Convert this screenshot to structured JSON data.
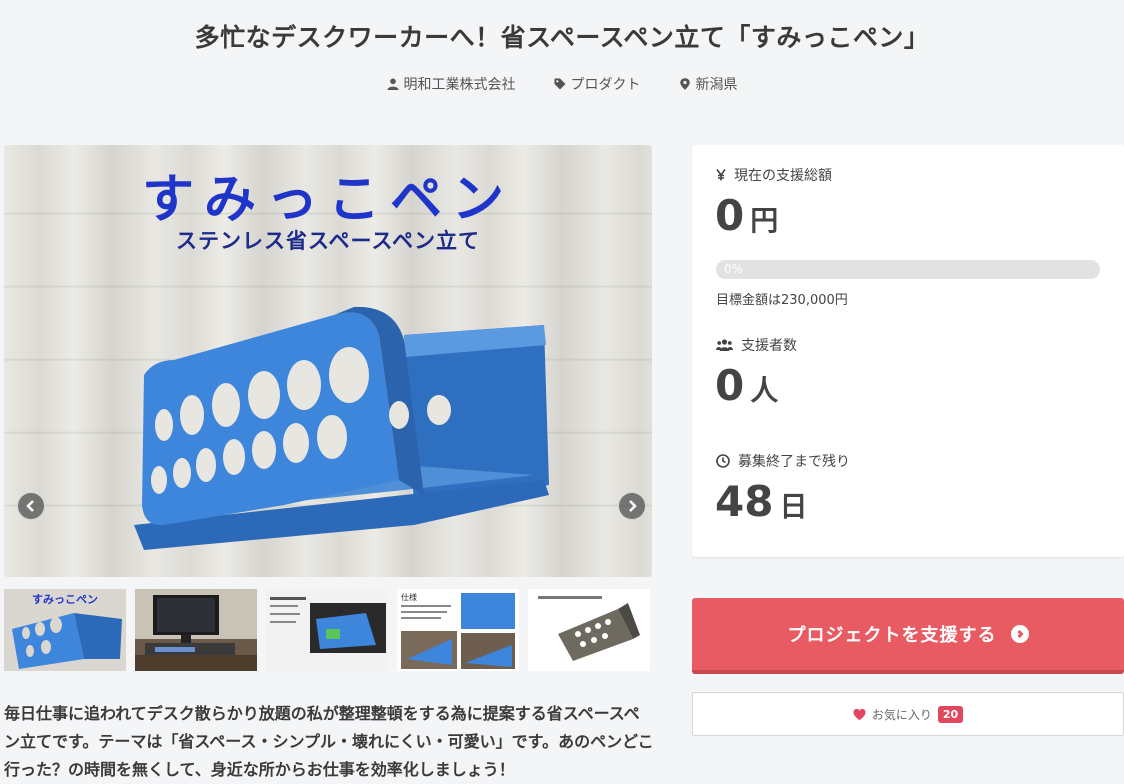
{
  "project": {
    "title": "多忙なデスクワーカーへ！省スペースペン立て「すみっこペン」",
    "owner": "明和工業株式会社",
    "category": "プロダクト",
    "location": "新潟県"
  },
  "hero": {
    "title": "すみっこペン",
    "subtitle": "ステンレス省スペースペン立て"
  },
  "description": "毎日仕事に追われてデスク散らかり放題の私が整理整頓をする為に提案する省スペースペン立てです。テーマは「省スペース・シンプル・壊れにくい・可愛い」です。あのペンどこ行った？の時間を無くして、身近な所からお仕事を効率化しましょう！",
  "panel": {
    "total_label": "現在の支援総額",
    "total_value": "0",
    "total_unit": "円",
    "progress_label": "0%",
    "progress_fraction": 0,
    "goal": "目標金額は230,000円",
    "backers_label": "支援者数",
    "backers_value": "0",
    "backers_unit": "人",
    "remaining_label": "募集終了まで残り",
    "remaining_value": "48",
    "remaining_unit": "日"
  },
  "actions": {
    "support_label": "プロジェクトを支援する",
    "favorite_label": "お気に入り",
    "favorite_count": "20"
  },
  "thumbs": {
    "t1_title": "すみっこペン",
    "t4_title": "仕様"
  },
  "icons": [
    "user-icon",
    "tag-icon",
    "pin-icon",
    "yen-icon",
    "people-icon",
    "clock-icon",
    "heart-icon",
    "chevron-left-icon",
    "chevron-right-icon"
  ],
  "colors": {
    "accent": "#e95b63",
    "heart": "#e0485f",
    "stand_blue": "#3a7fd0"
  }
}
